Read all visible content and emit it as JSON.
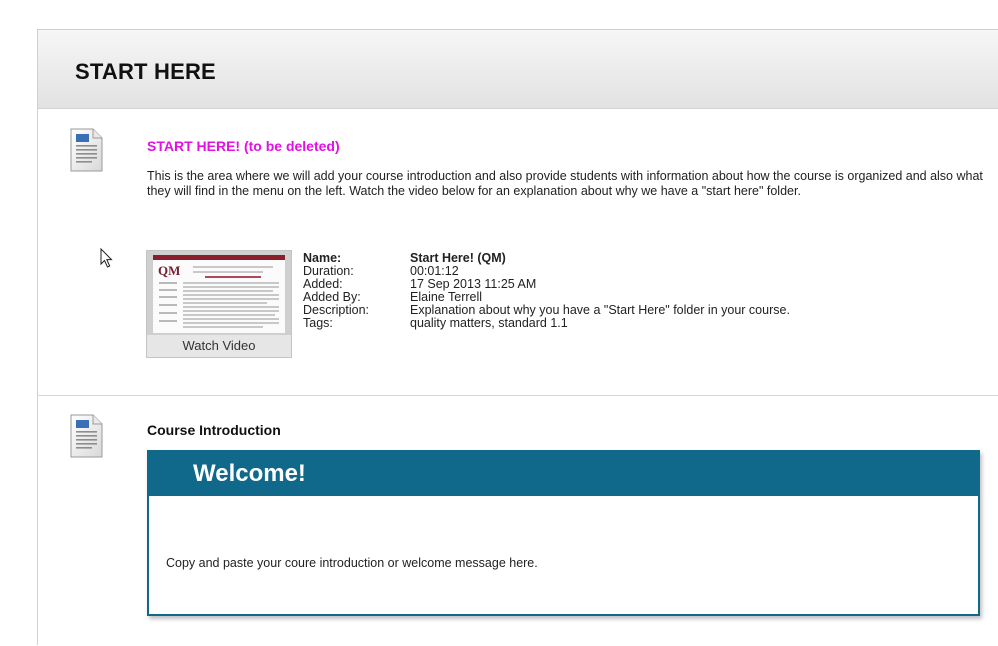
{
  "page": {
    "title": "START HERE"
  },
  "items": [
    {
      "title": "START HERE! (to be deleted)",
      "description": "This is the area where we will add your course introduction and also provide students with information about how the course is organized and also what they will find in the menu on the left. Watch the video below for an explanation about why we have a \"start here\" folder.",
      "icon": "document-icon",
      "video": {
        "thumbnail_logo": "QM",
        "watch_label": "Watch Video",
        "meta": [
          {
            "key": "Name:",
            "value": "Start Here! (QM)"
          },
          {
            "key": "Duration:",
            "value": "00:01:12"
          },
          {
            "key": "Added:",
            "value": "17 Sep 2013 11:25 AM"
          },
          {
            "key": "Added By:",
            "value": "Elaine Terrell"
          },
          {
            "key": "Description:",
            "value": "Explanation about why you have a \"Start Here\" folder in your course."
          },
          {
            "key": "Tags:",
            "value": "quality matters, standard 1.1"
          }
        ]
      }
    },
    {
      "title": "Course Introduction",
      "icon": "document-icon",
      "welcome": {
        "heading": "Welcome!",
        "body": "Copy and paste your coure introduction or welcome message here."
      }
    }
  ],
  "colors": {
    "title_accent": "#e40fe4",
    "welcome_accent": "#10698a"
  }
}
